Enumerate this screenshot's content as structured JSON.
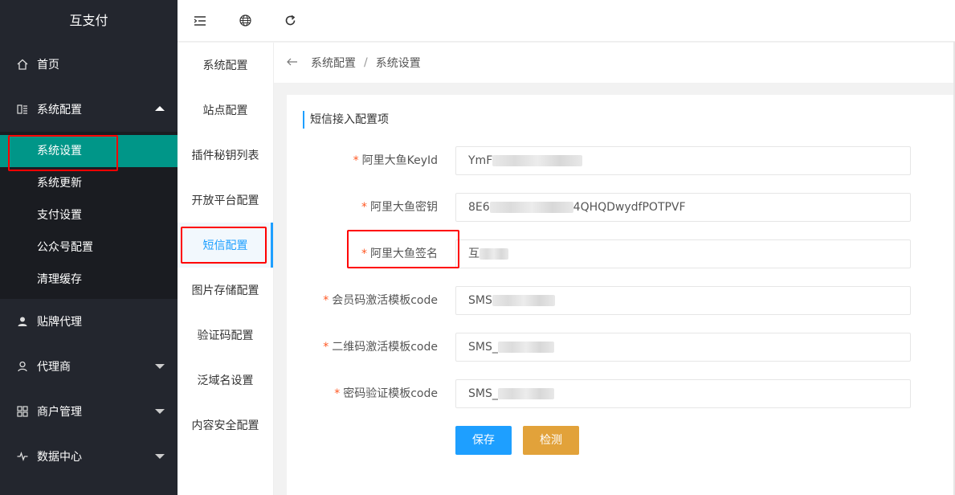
{
  "sidebar": {
    "logo": "互支付",
    "home": "首页",
    "system": "系统配置",
    "system_sub": [
      "系统设置",
      "系统更新",
      "支付设置",
      "公众号配置",
      "清理缓存"
    ],
    "brand_agent": "贴牌代理",
    "agent": "代理商",
    "merchant": "商户管理",
    "data_center": "数据中心"
  },
  "submenu": [
    "系统配置",
    "站点配置",
    "插件秘钥列表",
    "开放平台配置",
    "短信配置",
    "图片存储配置",
    "验证码配置",
    "泛域名设置",
    "内容安全配置"
  ],
  "breadcrumb": {
    "first": "系统配置",
    "sep": "/",
    "second": "系统设置"
  },
  "section_title": "短信接入配置项",
  "form": [
    {
      "label": "阿里大鱼KeyId",
      "value": "YmF"
    },
    {
      "label": "阿里大鱼密钥",
      "value_prefix": "8E6",
      "value_suffix": "4QHQDwydfPOTPVF"
    },
    {
      "label": "阿里大鱼签名",
      "value": "互"
    },
    {
      "label": "会员码激活模板code",
      "value": "SMS"
    },
    {
      "label": "二维码激活模板code",
      "value": "SMS_"
    },
    {
      "label": "密码验证模板code",
      "value": "SMS_"
    }
  ],
  "buttons": {
    "save": "保存",
    "detect": "检测"
  },
  "required_mark": "*",
  "colors": {
    "sidebar_bg": "#23262e",
    "active_green": "#009688",
    "accent_blue": "#1e9fff",
    "detect_orange": "#e2a23a",
    "annotation_red": "#ff0000"
  }
}
